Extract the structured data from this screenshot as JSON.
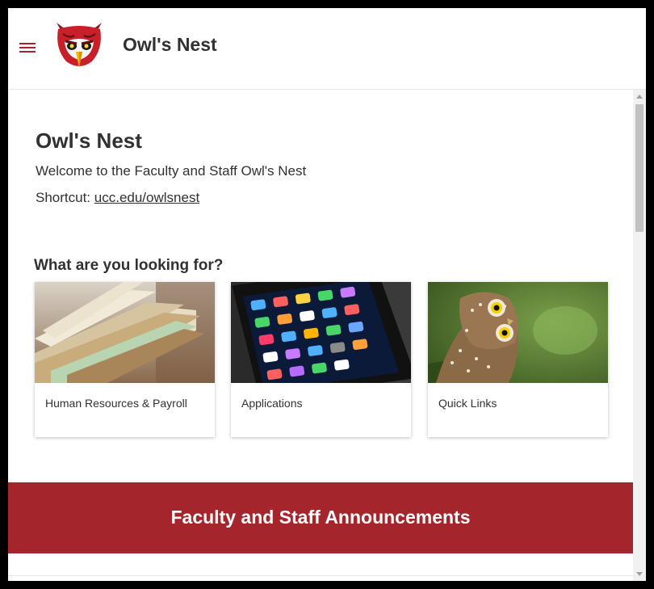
{
  "header": {
    "site_title": "Owl's Nest",
    "menu_icon": "hamburger-menu-icon",
    "logo": "owl-logo"
  },
  "main": {
    "page_title": "Owl's Nest",
    "welcome_text": "Welcome to the Faculty and Staff Owl's Nest",
    "shortcut_label": "Shortcut: ",
    "shortcut_link": "ucc.edu/owlsnest",
    "section_heading": "What are you looking for?",
    "cards": [
      {
        "label": "Human Resources & Payroll",
        "image": "file-folders"
      },
      {
        "label": "Applications",
        "image": "smartphone-apps"
      },
      {
        "label": "Quick Links",
        "image": "owl-photo"
      }
    ],
    "announcements_title": "Faculty and Staff Announcements"
  },
  "colors": {
    "accent": "#a4262c",
    "text": "#323130"
  }
}
